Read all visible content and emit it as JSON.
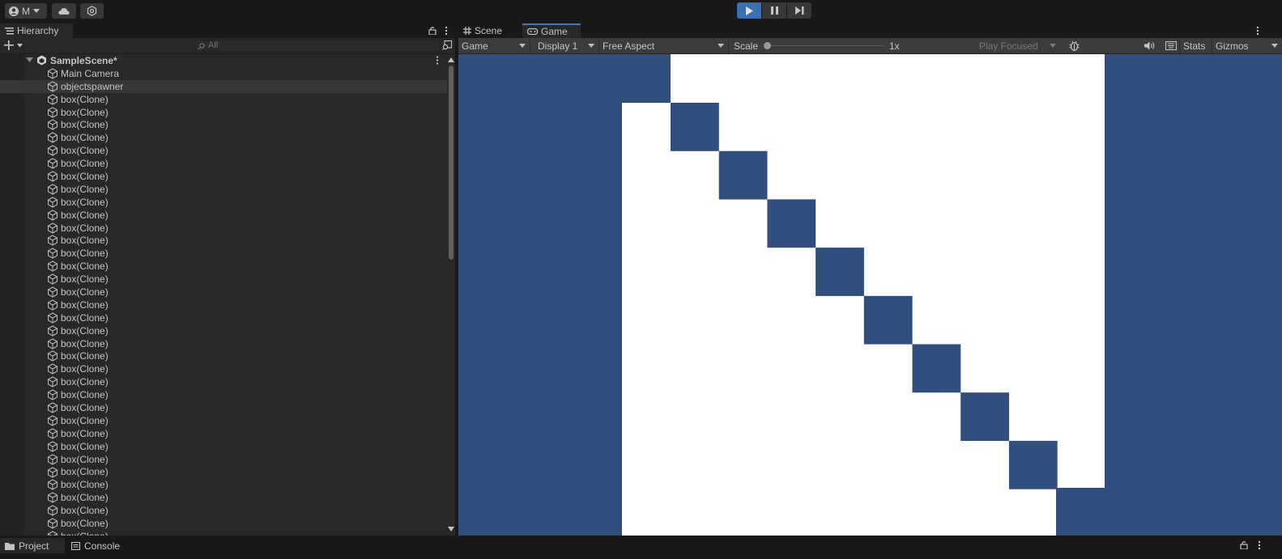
{
  "toolbar": {
    "account_initial": "M",
    "account_icon": "user-icon",
    "cloud_icon": "cloud-icon",
    "services_icon": "settings-icon",
    "play_icon": "play-icon",
    "pause_icon": "pause-icon",
    "step_icon": "step-icon"
  },
  "hierarchy": {
    "tab_label": "Hierarchy",
    "search_placeholder": "All",
    "scene_name": "SampleScene*",
    "items": [
      {
        "label": "Main Camera",
        "selected": false
      },
      {
        "label": "objectspawner",
        "selected": true
      },
      {
        "label": "box(Clone)"
      },
      {
        "label": "box(Clone)"
      },
      {
        "label": "box(Clone)"
      },
      {
        "label": "box(Clone)"
      },
      {
        "label": "box(Clone)"
      },
      {
        "label": "box(Clone)"
      },
      {
        "label": "box(Clone)"
      },
      {
        "label": "box(Clone)"
      },
      {
        "label": "box(Clone)"
      },
      {
        "label": "box(Clone)"
      },
      {
        "label": "box(Clone)"
      },
      {
        "label": "box(Clone)"
      },
      {
        "label": "box(Clone)"
      },
      {
        "label": "box(Clone)"
      },
      {
        "label": "box(Clone)"
      },
      {
        "label": "box(Clone)"
      },
      {
        "label": "box(Clone)"
      },
      {
        "label": "box(Clone)"
      },
      {
        "label": "box(Clone)"
      },
      {
        "label": "box(Clone)"
      },
      {
        "label": "box(Clone)"
      },
      {
        "label": "box(Clone)"
      },
      {
        "label": "box(Clone)"
      },
      {
        "label": "box(Clone)"
      },
      {
        "label": "box(Clone)"
      },
      {
        "label": "box(Clone)"
      },
      {
        "label": "box(Clone)"
      },
      {
        "label": "box(Clone)"
      },
      {
        "label": "box(Clone)"
      },
      {
        "label": "box(Clone)"
      },
      {
        "label": "box(Clone)"
      },
      {
        "label": "box(Clone)"
      },
      {
        "label": "box(Clone)"
      },
      {
        "label": "box(Clone)"
      },
      {
        "label": "box(Clone)"
      }
    ]
  },
  "game_panel": {
    "tabs": [
      {
        "label": "Scene"
      },
      {
        "label": "Game"
      }
    ],
    "view_mode": "Game",
    "display": "Display 1",
    "aspect": "Free Aspect",
    "scale_label": "Scale",
    "scale_value": "1x",
    "play_mode": "Play Focused",
    "stats_label": "Stats",
    "gizmos_label": "Gizmos",
    "background_color": "#314f7e",
    "box_color": "#ffffff"
  },
  "bottom": {
    "tabs": [
      {
        "label": "Project"
      },
      {
        "label": "Console"
      }
    ]
  }
}
